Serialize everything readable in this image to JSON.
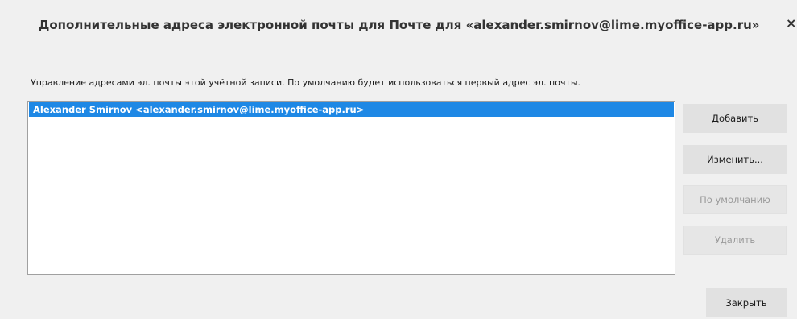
{
  "dialog": {
    "title": "Дополнительные адреса электронной почты для Почте для «alexander.smirnov@lime.myoffice-app.ru»",
    "close_glyph": "×",
    "description": "Управление адресами эл. почты этой учётной записи. По умолчанию будет использоваться первый адрес эл. почты.",
    "addresses": [
      "Alexander Smirnov <alexander.smirnov@lime.myoffice-app.ru>"
    ],
    "buttons": {
      "add": "Добавить",
      "edit": "Изменить...",
      "set_default": "По умолчанию",
      "delete": "Удалить",
      "close": "Закрыть"
    },
    "colors": {
      "selection": "#1e88e5",
      "background": "#f0f0f0",
      "button": "#e1e1e1",
      "disabled_text": "#9a9a9a"
    }
  }
}
